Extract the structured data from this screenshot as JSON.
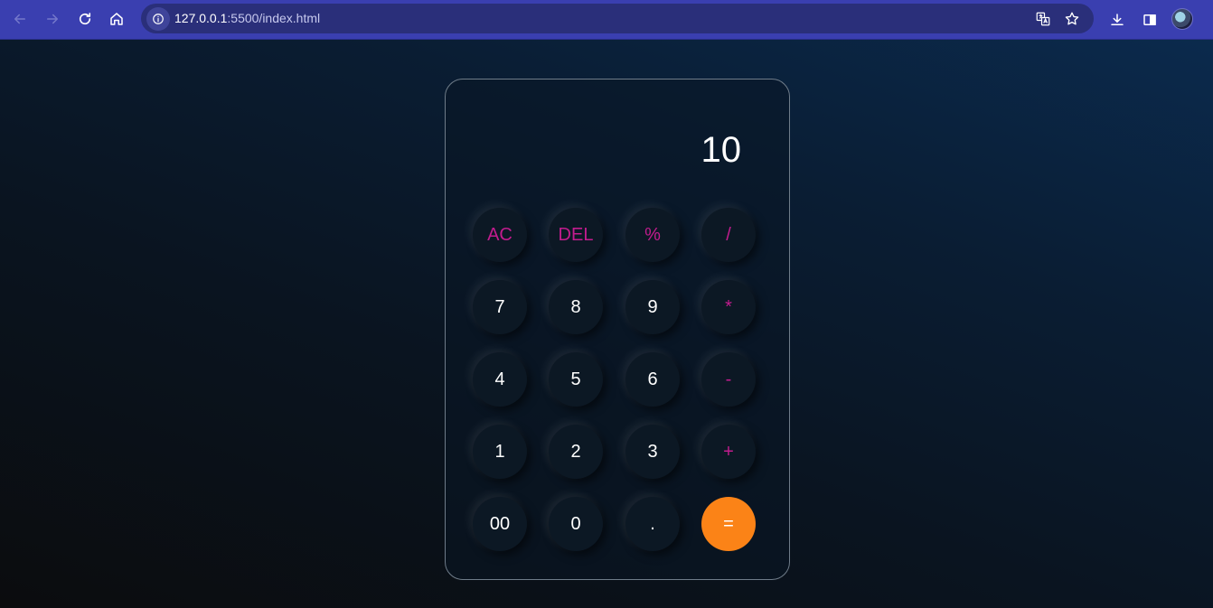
{
  "browser": {
    "url_host": "127.0.0.1",
    "url_path": ":5500/index.html"
  },
  "calculator": {
    "display_value": "10",
    "rows": [
      [
        {
          "label": "AC",
          "name": "clear-all-button",
          "type": "op"
        },
        {
          "label": "DEL",
          "name": "delete-button",
          "type": "op"
        },
        {
          "label": "%",
          "name": "percent-button",
          "type": "op"
        },
        {
          "label": "/",
          "name": "divide-button",
          "type": "op"
        }
      ],
      [
        {
          "label": "7",
          "name": "digit-7-button",
          "type": "num"
        },
        {
          "label": "8",
          "name": "digit-8-button",
          "type": "num"
        },
        {
          "label": "9",
          "name": "digit-9-button",
          "type": "num"
        },
        {
          "label": "*",
          "name": "multiply-button",
          "type": "op"
        }
      ],
      [
        {
          "label": "4",
          "name": "digit-4-button",
          "type": "num"
        },
        {
          "label": "5",
          "name": "digit-5-button",
          "type": "num"
        },
        {
          "label": "6",
          "name": "digit-6-button",
          "type": "num"
        },
        {
          "label": "-",
          "name": "subtract-button",
          "type": "op"
        }
      ],
      [
        {
          "label": "1",
          "name": "digit-1-button",
          "type": "num"
        },
        {
          "label": "2",
          "name": "digit-2-button",
          "type": "num"
        },
        {
          "label": "3",
          "name": "digit-3-button",
          "type": "num"
        },
        {
          "label": "+",
          "name": "add-button",
          "type": "op"
        }
      ],
      [
        {
          "label": "00",
          "name": "double-zero-button",
          "type": "num"
        },
        {
          "label": "0",
          "name": "digit-0-button",
          "type": "num"
        },
        {
          "label": ".",
          "name": "decimal-button",
          "type": "num"
        },
        {
          "label": "=",
          "name": "equals-button",
          "type": "equal"
        }
      ]
    ]
  },
  "colors": {
    "operator_text": "#c21c8e",
    "equals_bg": "#fb8317",
    "browser_bar": "#3a3fb0"
  },
  "icons": [
    "back-arrow-icon",
    "forward-arrow-icon",
    "reload-icon",
    "home-icon",
    "info-icon",
    "translate-icon",
    "star-icon",
    "download-icon",
    "side-panel-icon"
  ]
}
